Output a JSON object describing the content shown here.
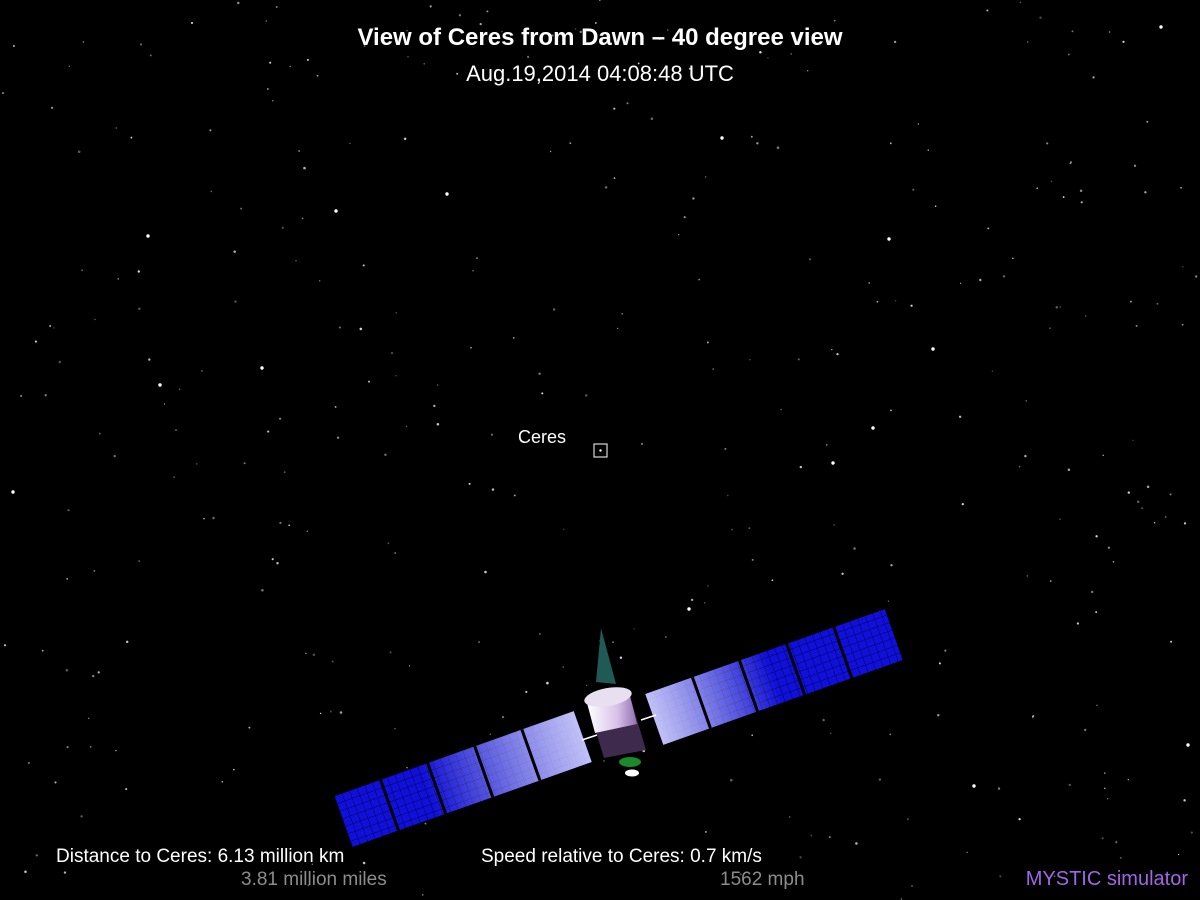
{
  "header": {
    "title": "View of Ceres from Dawn – 40 degree view",
    "timestamp": "Aug.19,2014 04:08:48 UTC"
  },
  "target": {
    "label": "Ceres"
  },
  "readouts": {
    "distance": {
      "primary": "Distance to Ceres: 6.13 million km",
      "secondary": "3.81 million miles"
    },
    "speed": {
      "primary": "Speed relative to Ceres: 0.7 km/s",
      "secondary": "1562 mph"
    }
  },
  "branding": {
    "label": "MYSTIC simulator"
  },
  "colors": {
    "background": "#000000",
    "solar_panel": "#1010d8",
    "panel_grid": "#000050",
    "brand": "#a066e6",
    "secondary_text": "#8c8c8c",
    "antenna": "#1f5a55",
    "bus_light": "#ffffff",
    "bus_dark": "#3d2a4d"
  }
}
